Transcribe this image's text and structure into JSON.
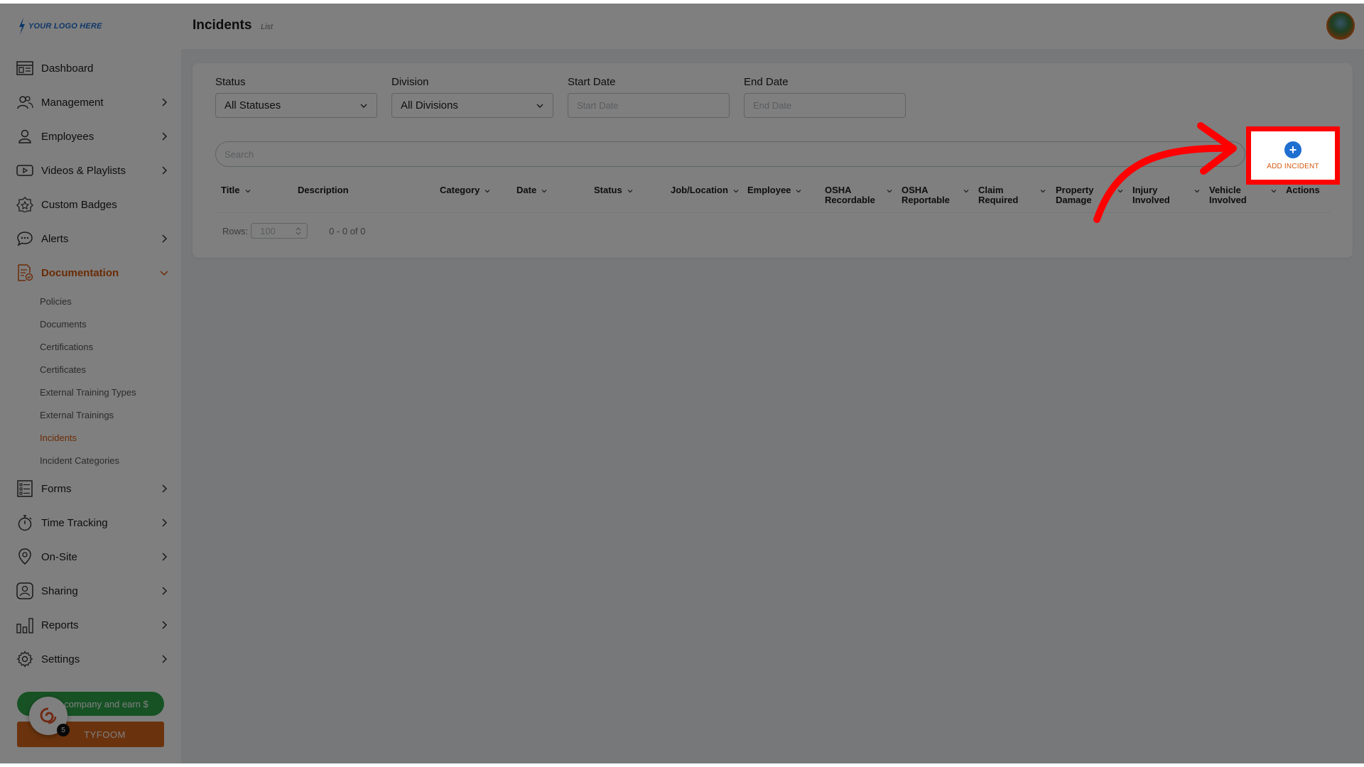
{
  "logo": {
    "text": "YOUR LOGO HERE"
  },
  "sidebar": {
    "items": [
      {
        "label": "Dashboard",
        "icon": "dashboard-icon",
        "has_chevron": false
      },
      {
        "label": "Management",
        "icon": "people-icon",
        "has_chevron": true
      },
      {
        "label": "Employees",
        "icon": "person-icon",
        "has_chevron": true
      },
      {
        "label": "Videos & Playlists",
        "icon": "video-icon",
        "has_chevron": true
      },
      {
        "label": "Custom Badges",
        "icon": "badge-icon",
        "has_chevron": false
      },
      {
        "label": "Alerts",
        "icon": "chat-icon",
        "has_chevron": true
      },
      {
        "label": "Documentation",
        "icon": "document-check-icon",
        "has_chevron": true,
        "active": true
      }
    ],
    "sub_items": [
      {
        "label": "Policies"
      },
      {
        "label": "Documents"
      },
      {
        "label": "Certifications"
      },
      {
        "label": "Certificates"
      },
      {
        "label": "External Training Types"
      },
      {
        "label": "External Trainings"
      },
      {
        "label": "Incidents",
        "active": true
      },
      {
        "label": "Incident Categories"
      }
    ],
    "items_after": [
      {
        "label": "Forms",
        "icon": "form-icon"
      },
      {
        "label": "Time Tracking",
        "icon": "stopwatch-icon"
      },
      {
        "label": "On-Site",
        "icon": "location-pin-icon"
      },
      {
        "label": "Sharing",
        "icon": "share-user-icon"
      },
      {
        "label": "Reports",
        "icon": "bar-chart-icon"
      },
      {
        "label": "Settings",
        "icon": "gear-icon"
      }
    ],
    "refer_label": "Refer company and earn $",
    "refer_visible": "company and earn $",
    "tyfoom_label": "TYFOOM",
    "chat_badge_count": "5"
  },
  "header": {
    "title": "Incidents",
    "subtitle": "List"
  },
  "filters": {
    "status": {
      "label": "Status",
      "value": "All Statuses"
    },
    "division": {
      "label": "Division",
      "value": "All Divisions"
    },
    "start_date": {
      "label": "Start Date",
      "placeholder": "Start Date"
    },
    "end_date": {
      "label": "End Date",
      "placeholder": "End Date"
    }
  },
  "search": {
    "placeholder": "Search"
  },
  "add_button": {
    "label": "ADD INCIDENT"
  },
  "table": {
    "columns": [
      {
        "label": "Title",
        "sortable": true
      },
      {
        "label": "Description",
        "sortable": false
      },
      {
        "label": "Category",
        "sortable": true
      },
      {
        "label": "Date",
        "sortable": true
      },
      {
        "label": "Status",
        "sortable": true
      },
      {
        "label": "Job/Location",
        "sortable": true
      },
      {
        "label": "Employee",
        "sortable": true
      },
      {
        "label": "OSHA Recordable",
        "sortable": true
      },
      {
        "label": "OSHA Reportable",
        "sortable": true
      },
      {
        "label": "Claim Required",
        "sortable": true
      },
      {
        "label": "Property Damage",
        "sortable": true
      },
      {
        "label": "Injury Involved",
        "sortable": true
      },
      {
        "label": "Vehicle Involved",
        "sortable": true
      },
      {
        "label": "Actions",
        "sortable": false
      }
    ],
    "rows_label": "Rows:",
    "rows_per_page": "100",
    "range_text": "0 - 0 of 0"
  },
  "colors": {
    "accent": "#d4580f",
    "primary": "#1f6fd1",
    "highlight": "#ff0000",
    "refer_green": "#2fa44a"
  }
}
